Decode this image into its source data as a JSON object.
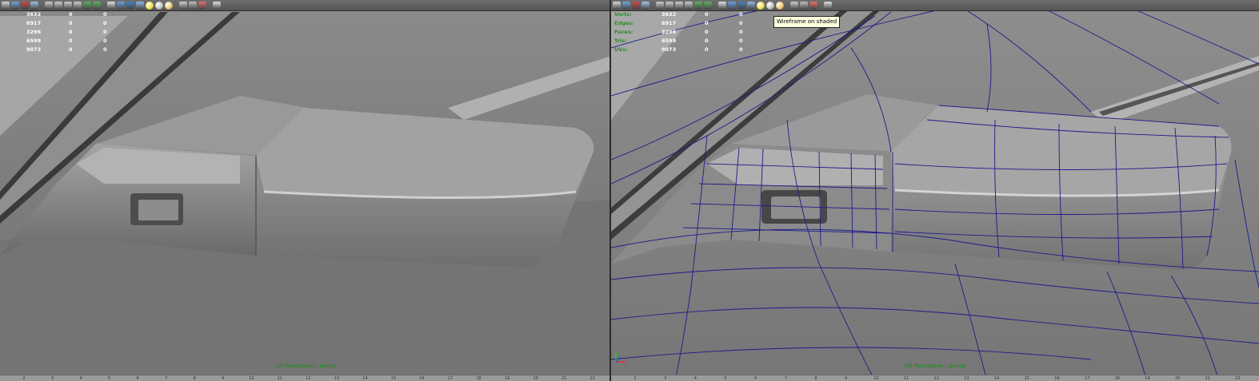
{
  "left_viewport": {
    "camera_label": "2D Pan/Zoom : persp",
    "stats": [
      {
        "label": "",
        "values": [
          "3632",
          "0",
          "0"
        ]
      },
      {
        "label": "",
        "values": [
          "6917",
          "0",
          "0"
        ]
      },
      {
        "label": "",
        "values": [
          "3296",
          "0",
          "0"
        ]
      },
      {
        "label": "",
        "values": [
          "6599",
          "0",
          "0"
        ]
      },
      {
        "label": "",
        "values": [
          "9073",
          "0",
          "0"
        ]
      }
    ],
    "ruler": [
      "2",
      "3",
      "4",
      "5",
      "6",
      "7",
      "8",
      "9",
      "10",
      "11",
      "12",
      "13",
      "14",
      "15",
      "16",
      "17",
      "18",
      "19",
      "20",
      "21",
      "22"
    ]
  },
  "right_viewport": {
    "camera_label": "2D Pan/Zoom : persp",
    "stats": [
      {
        "label": "Verts:",
        "values": [
          "3632",
          "0",
          "0"
        ]
      },
      {
        "label": "Edges:",
        "values": [
          "6917",
          "0",
          "0"
        ]
      },
      {
        "label": "Faces:",
        "values": [
          "3296",
          "0",
          "0"
        ]
      },
      {
        "label": "Tris:",
        "values": [
          "6599",
          "0",
          "0"
        ]
      },
      {
        "label": "UVs:",
        "values": [
          "9073",
          "0",
          "0"
        ]
      }
    ],
    "tooltip": "Wireframe on shaded",
    "ruler": [
      "2",
      "3",
      "4",
      "5",
      "6",
      "7",
      "8",
      "9",
      "10",
      "11",
      "12",
      "13",
      "14",
      "15",
      "16",
      "17",
      "18",
      "19",
      "20",
      "21",
      "22"
    ]
  },
  "toolbar_icons": [
    "select-camera-icon",
    "camera-attributes-icon",
    "bookmark-icon",
    "image-plane-icon",
    "grid-icon",
    "film-gate-icon",
    "resolution-gate-icon",
    "field-chart-icon",
    "safe-action-icon",
    "safe-title-icon",
    "wireframe-icon",
    "smooth-shade-icon",
    "wireframe-on-shaded-icon",
    "textured-icon",
    "use-all-lights-icon",
    "shadows-icon",
    "screen-space-ao-icon",
    "isolate-select-icon",
    "xray-icon",
    "xray-joints-icon",
    "frame-selection-icon"
  ],
  "colors": {
    "wire": "#1f1a8a",
    "hud_label": "#2e8a2e",
    "camera_label": "#2d8a2d",
    "tooltip_bg": "#ffffe1"
  }
}
